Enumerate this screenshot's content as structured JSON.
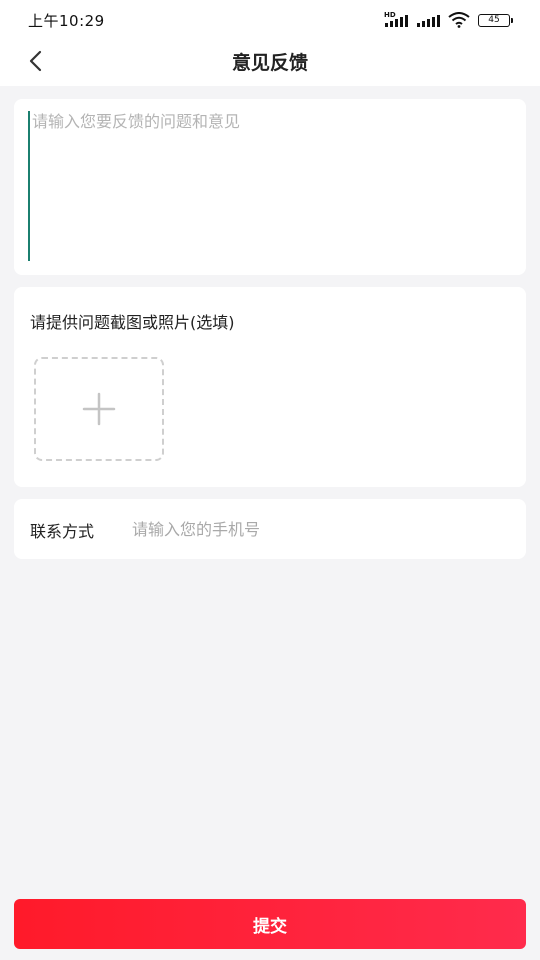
{
  "status_bar": {
    "time": "上午10:29",
    "network_label": "HD",
    "battery_level": "45",
    "icons": [
      "signal-hd-icon",
      "signal-icon",
      "wifi-icon",
      "battery-icon"
    ]
  },
  "nav": {
    "title": "意见反馈",
    "back_icon": "chevron-left-icon"
  },
  "feedback": {
    "value": "",
    "placeholder": "请输入您要反馈的问题和意见"
  },
  "screenshot": {
    "label": "请提供问题截图或照片(选填)",
    "add_icon": "plus-icon"
  },
  "contact": {
    "label": "联系方式",
    "value": "",
    "placeholder": "请输入您的手机号"
  },
  "submit": {
    "label": "提交"
  },
  "colors": {
    "accent": "#ff1f35",
    "background": "#f4f4f6",
    "card": "#ffffff",
    "placeholder": "#b4b4b4"
  }
}
